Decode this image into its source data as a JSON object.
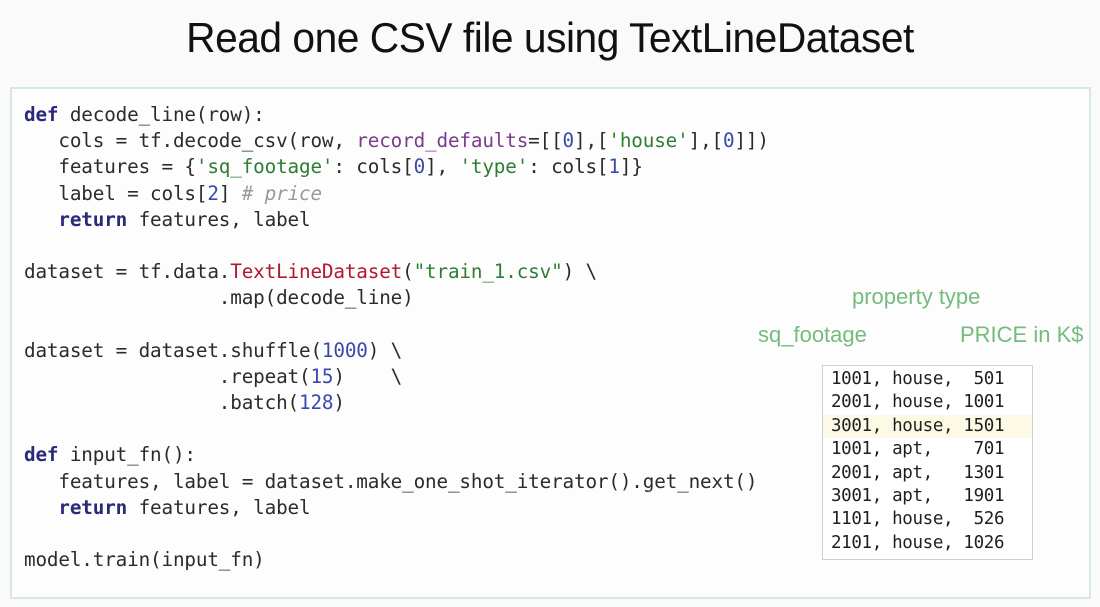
{
  "slide": {
    "title": "Read one CSV file using TextLineDataset"
  },
  "code": {
    "lines": [
      [
        {
          "t": "def",
          "c": "kw"
        },
        {
          "t": " decode_line(row):",
          "c": ""
        }
      ],
      [
        {
          "t": "   cols = tf.decode_csv(row, ",
          "c": ""
        },
        {
          "t": "record_defaults",
          "c": "param"
        },
        {
          "t": "=[[",
          "c": ""
        },
        {
          "t": "0",
          "c": "num"
        },
        {
          "t": "],[",
          "c": ""
        },
        {
          "t": "'house'",
          "c": "str"
        },
        {
          "t": "],[",
          "c": ""
        },
        {
          "t": "0",
          "c": "num"
        },
        {
          "t": "]])",
          "c": ""
        }
      ],
      [
        {
          "t": "   features = {",
          "c": ""
        },
        {
          "t": "'sq_footage'",
          "c": "str"
        },
        {
          "t": ": cols[",
          "c": ""
        },
        {
          "t": "0",
          "c": "num"
        },
        {
          "t": "], ",
          "c": ""
        },
        {
          "t": "'type'",
          "c": "str"
        },
        {
          "t": ": cols[",
          "c": ""
        },
        {
          "t": "1",
          "c": "num"
        },
        {
          "t": "]}",
          "c": ""
        }
      ],
      [
        {
          "t": "   label = cols[",
          "c": ""
        },
        {
          "t": "2",
          "c": "num"
        },
        {
          "t": "] ",
          "c": ""
        },
        {
          "t": "# price",
          "c": "cmt"
        }
      ],
      [
        {
          "t": "   ",
          "c": ""
        },
        {
          "t": "return",
          "c": "kw"
        },
        {
          "t": " features, label",
          "c": ""
        }
      ],
      [
        {
          "t": "",
          "c": ""
        }
      ],
      [
        {
          "t": "dataset = tf.data.",
          "c": ""
        },
        {
          "t": "TextLineDataset",
          "c": "fn-red"
        },
        {
          "t": "(",
          "c": ""
        },
        {
          "t": "\"train_1.csv\"",
          "c": "str"
        },
        {
          "t": ") \\",
          "c": ""
        }
      ],
      [
        {
          "t": "                 .map(decode_line)",
          "c": ""
        }
      ],
      [
        {
          "t": "",
          "c": ""
        }
      ],
      [
        {
          "t": "dataset = dataset.shuffle(",
          "c": ""
        },
        {
          "t": "1000",
          "c": "num"
        },
        {
          "t": ") \\",
          "c": ""
        }
      ],
      [
        {
          "t": "                 .repeat(",
          "c": ""
        },
        {
          "t": "15",
          "c": "num"
        },
        {
          "t": ")    \\",
          "c": ""
        }
      ],
      [
        {
          "t": "                 .batch(",
          "c": ""
        },
        {
          "t": "128",
          "c": "num"
        },
        {
          "t": ")",
          "c": ""
        }
      ],
      [
        {
          "t": "",
          "c": ""
        }
      ],
      [
        {
          "t": "def",
          "c": "kw"
        },
        {
          "t": " input_fn():",
          "c": ""
        }
      ],
      [
        {
          "t": "   features, label = dataset.make_one_shot_iterator().get_next()",
          "c": ""
        }
      ],
      [
        {
          "t": "   ",
          "c": ""
        },
        {
          "t": "return",
          "c": "kw"
        },
        {
          "t": " features, label",
          "c": ""
        }
      ],
      [
        {
          "t": "",
          "c": ""
        }
      ],
      [
        {
          "t": "model.train(input_fn)",
          "c": ""
        }
      ]
    ]
  },
  "annotations": {
    "property_type": "property type",
    "sq_footage": "sq_footage",
    "price": "PRICE in K$"
  },
  "csv": {
    "highlight_row": 2,
    "rows": [
      "1001, house,  501",
      "2001, house, 1001",
      "3001, house, 1501",
      "1001, apt,    701",
      "2001, apt,   1301",
      "3001, apt,   1901",
      "1101, house,  526",
      "2101, house, 1026"
    ]
  },
  "colors": {
    "keyword": "#2a2a7c",
    "string": "#2e7d32",
    "number": "#3949ab",
    "class_name": "#b0182c",
    "param": "#7b3a8c",
    "comment": "#9a9a9a",
    "annotation": "#74bb7c",
    "highlight": "#fcfae4",
    "code_border": "#d6eadb"
  }
}
